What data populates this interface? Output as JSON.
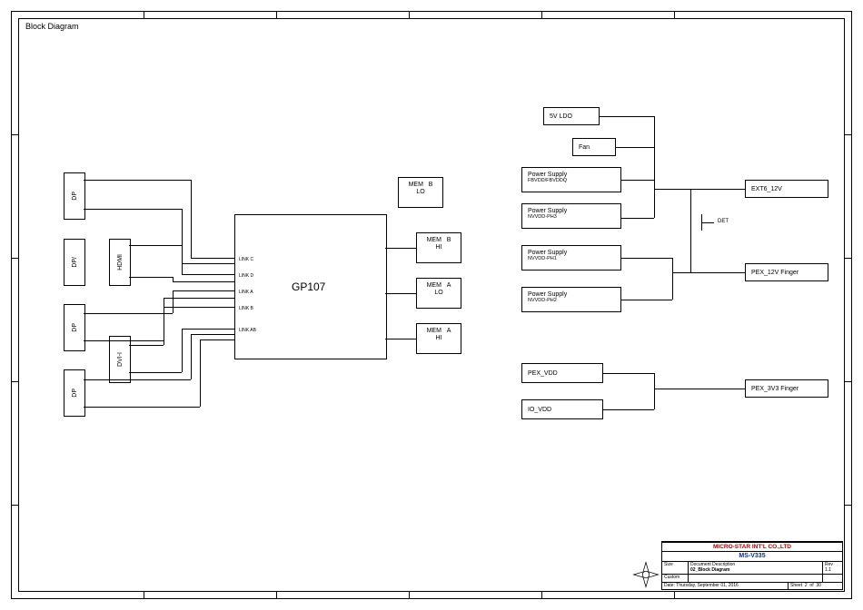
{
  "title": "Block Diagram",
  "gpu": {
    "label": "GP107",
    "pins": [
      "LINK C",
      "LINK D",
      "LINK A",
      "LINK B",
      "LINK AB"
    ]
  },
  "connectors": {
    "dp1": "DP",
    "dp_hdmi_left": "DP/",
    "hdmi": "HDMI",
    "dp2": "DP",
    "dvi": "DVI-I",
    "dp3": "DP"
  },
  "mems": [
    {
      "l1": "MEM",
      "l2": "B",
      "l3": "LO"
    },
    {
      "l1": "MEM",
      "l2": "B",
      "l3": "HI"
    },
    {
      "l1": "MEM",
      "l2": "A",
      "l3": "LO"
    },
    {
      "l1": "MEM",
      "l2": "A",
      "l3": "HI"
    }
  ],
  "power": {
    "ldo": "5V LDO",
    "fan": "Fan",
    "ps1": {
      "t": "Power Supply",
      "s": "FBVDD/FBVDDQ"
    },
    "ps2": {
      "t": "Power Supply",
      "s": "NVVDD-PH3"
    },
    "ps3": {
      "t": "Power Supply",
      "s": "NVVDD-PH1"
    },
    "ps4": {
      "t": "Power Supply",
      "s": "NVVDD-PH2"
    },
    "pex_vdd": "PEX_VDD",
    "io_vdd": "IO_VDD"
  },
  "rails": {
    "ext6": "EXT6_12V",
    "det": "DET",
    "pex12v": "PEX_12V Finger",
    "pex3v3": "PEX_3V3 Finger"
  },
  "titleblock": {
    "company": "MICRO-STAR INT'L CO.,LTD",
    "board": "MS-V335",
    "docdesc_label": "Document Description",
    "docdesc": "02_Block Diagram",
    "custom": "Custom",
    "size": "Size",
    "date_label": "Date:",
    "date": "Thursday, September 01, 2016",
    "sheet_label": "Sheet",
    "sheet": "2",
    "of_label": "of",
    "of": "30",
    "rev_label": "Rev",
    "rev": "1.1"
  }
}
